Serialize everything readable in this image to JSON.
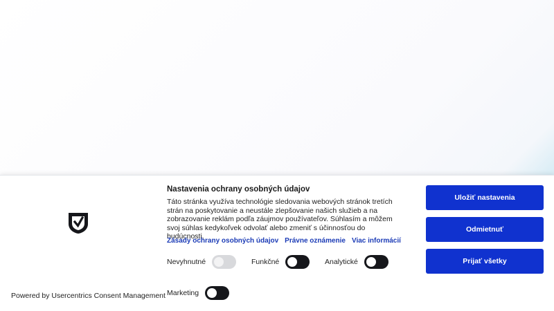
{
  "consent": {
    "title": "Nastavenia ochrany osobných údajov",
    "description": "Táto stránka využíva technológie sledovania webových stránok tretích strán na poskytovanie a neustále zlepšovanie našich služieb a na zobrazovanie reklám podľa záujmov používateľov. Súhlasím a môžem svoj súhlas kedykoľvek odvolať alebo zmeniť s účinnosťou do budúcnosti.",
    "links": {
      "privacy": "Zásady ochrany osobných údajov",
      "legal": "Právne oznámenie",
      "more": "Viac informácií"
    },
    "toggles": {
      "necessary": "Nevyhnutné",
      "functional": "Funkčné",
      "analytics": "Analytické",
      "marketing": "Marketing"
    },
    "buttons": {
      "save": "Uložiť nastavenia",
      "reject": "Odmietnuť",
      "accept_all": "Prijať všetky"
    },
    "powered_by": "Powered by Usercentrics Consent Management",
    "colors": {
      "accent": "#1032cf",
      "link": "#1b3bb6",
      "toggle_on": "#16171b",
      "toggle_disabled": "#d8d9dc"
    },
    "logo_icon": "usercentrics-shield-icon"
  }
}
